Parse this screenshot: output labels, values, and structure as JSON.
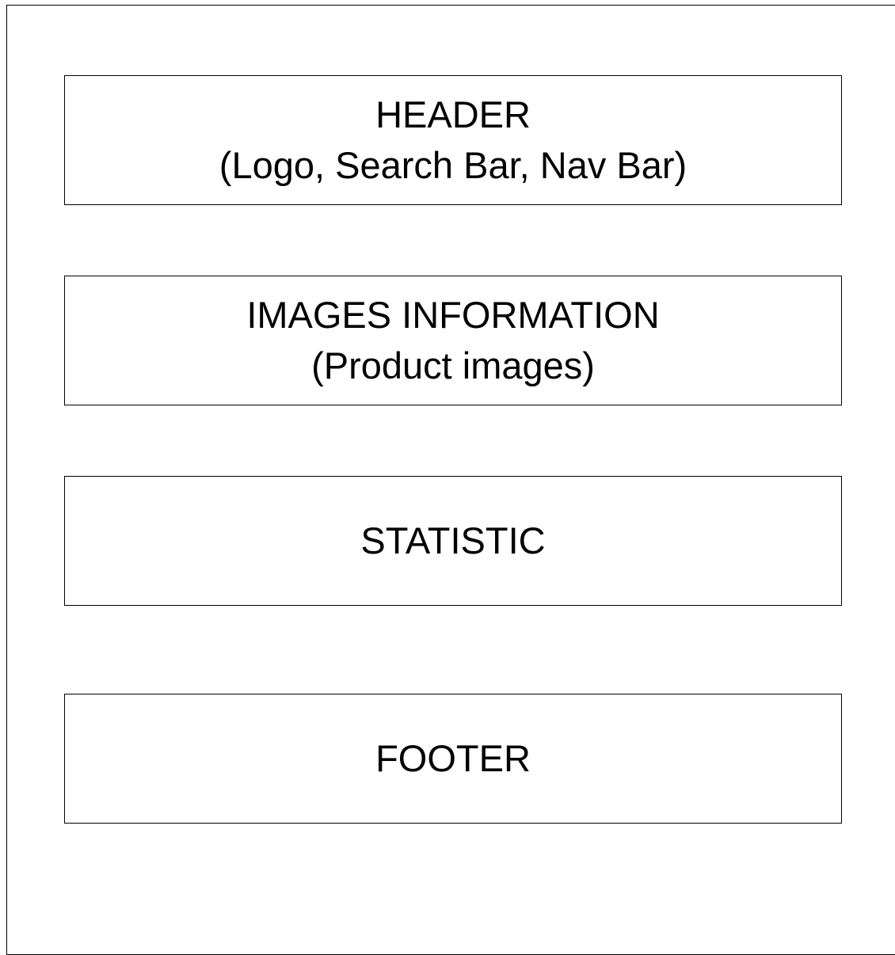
{
  "blocks": {
    "header": {
      "title": "HEADER",
      "subtitle": "(Logo, Search Bar, Nav Bar)"
    },
    "images": {
      "title": "IMAGES INFORMATION",
      "subtitle": "(Product images)"
    },
    "statistic": {
      "title": "STATISTIC"
    },
    "footer": {
      "title": "FOOTER"
    }
  },
  "colors": {
    "background": "#ffffff",
    "stroke": "#000000",
    "text": "#000000"
  }
}
